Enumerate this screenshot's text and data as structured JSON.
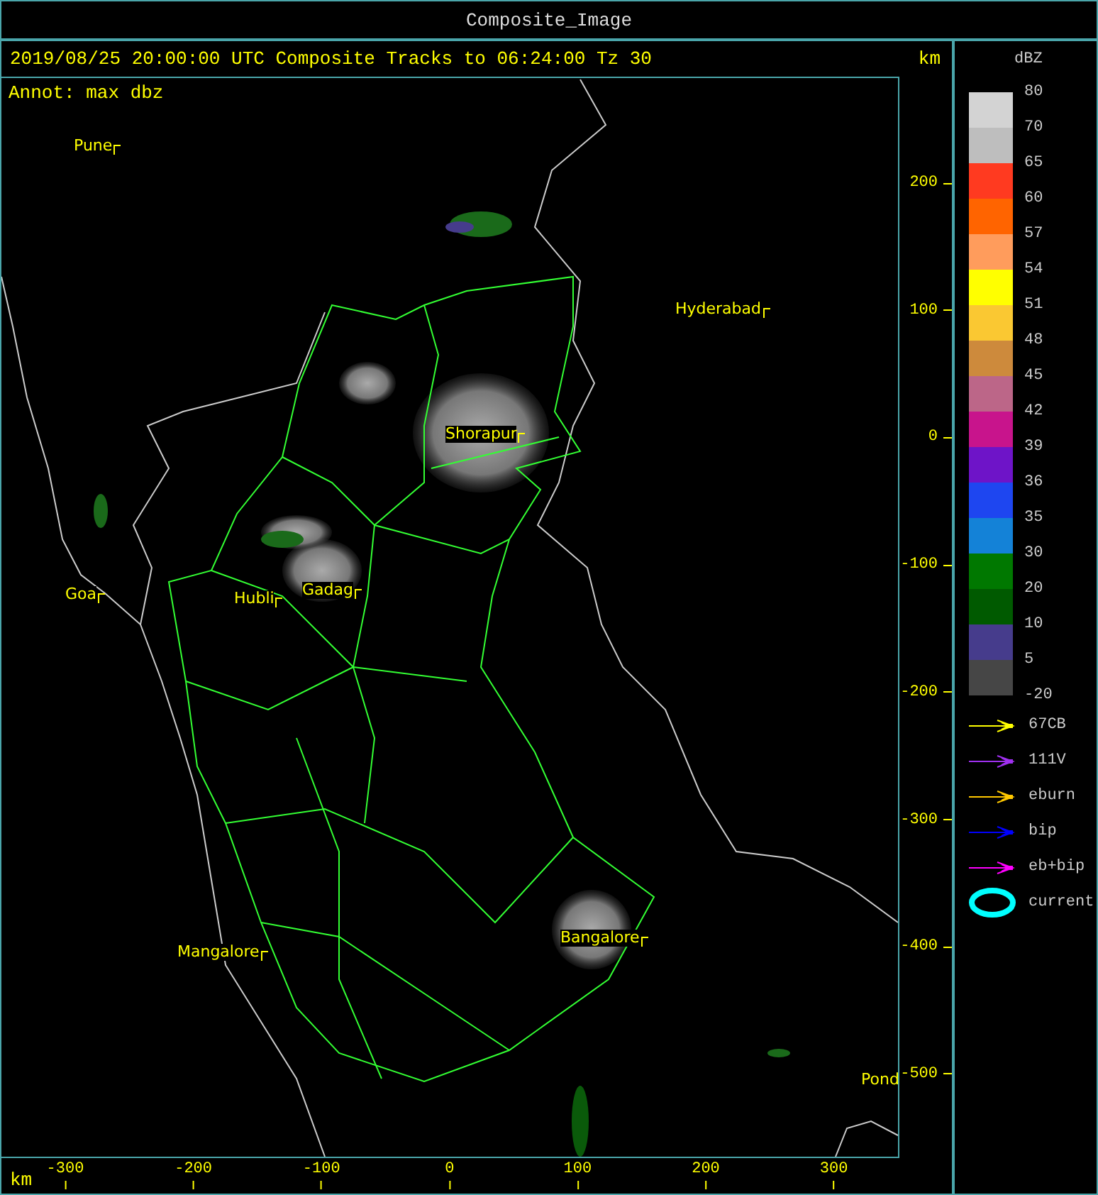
{
  "window": {
    "title": "Composite_Image"
  },
  "header": {
    "text": "2019/08/25 20:00:00 UTC Composite Tracks to 06:24:00 Tz 30",
    "y_unit": "km"
  },
  "annotation": "Annot: max dbz",
  "cities": [
    {
      "name": "Pune"
    },
    {
      "name": "Hyderabad"
    },
    {
      "name": "Shorapur"
    },
    {
      "name": "Goa"
    },
    {
      "name": "Hubli"
    },
    {
      "name": "Gadag"
    },
    {
      "name": "Mangalore"
    },
    {
      "name": "Bangalore"
    },
    {
      "name": "Pond"
    }
  ],
  "y_axis": {
    "ticks": [
      "200",
      "100",
      "0",
      "-100",
      "-200",
      "-300",
      "-400",
      "-500"
    ]
  },
  "x_axis": {
    "unit": "km",
    "ticks": [
      "-300",
      "-200",
      "-100",
      "0",
      "100",
      "200",
      "300"
    ]
  },
  "color_scale": {
    "unit": "dBZ",
    "bands": [
      {
        "color": "#d3d3d3"
      },
      {
        "color": "#bebebe"
      },
      {
        "color": "#ff3a20"
      },
      {
        "color": "#ff6400"
      },
      {
        "color": "#ff9c5c"
      },
      {
        "color": "#ffff00"
      },
      {
        "color": "#fac832"
      },
      {
        "color": "#cd8a3c"
      },
      {
        "color": "#bc6688"
      },
      {
        "color": "#c8148c"
      },
      {
        "color": "#6e14c8"
      },
      {
        "color": "#1e46f0"
      },
      {
        "color": "#1482d7"
      },
      {
        "color": "#007800"
      },
      {
        "color": "#005a00"
      },
      {
        "color": "#463c8c"
      },
      {
        "color": "#464646"
      }
    ],
    "labels": [
      "80",
      "70",
      "65",
      "60",
      "57",
      "54",
      "51",
      "48",
      "45",
      "42",
      "39",
      "36",
      "35",
      "30",
      "20",
      "10",
      "5",
      "-20"
    ]
  },
  "tracks": [
    {
      "kind": "arrow",
      "label": "67CB",
      "color": "#ffff00"
    },
    {
      "kind": "arrow",
      "label": "111V",
      "color": "#a030f0"
    },
    {
      "kind": "arrow",
      "label": "eburn",
      "color": "#ffc800"
    },
    {
      "kind": "arrow",
      "label": "bip",
      "color": "#0000ff"
    },
    {
      "kind": "arrow",
      "label": "eb+bip",
      "color": "#ff00ff"
    },
    {
      "kind": "ellipse",
      "label": "current",
      "color": "#00ffff"
    }
  ]
}
